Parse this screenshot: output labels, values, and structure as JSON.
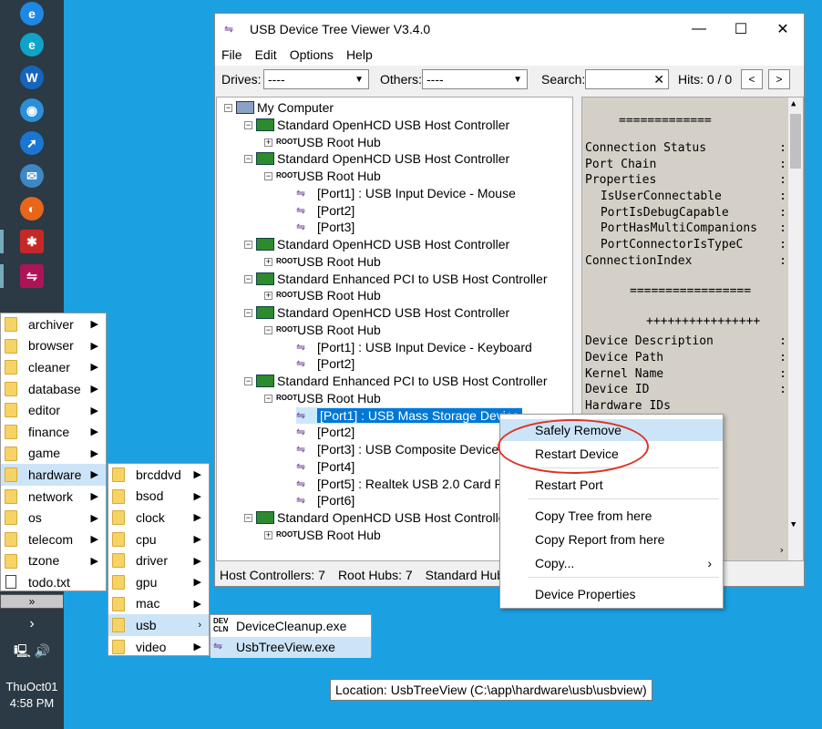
{
  "window": {
    "title": "USB Device Tree Viewer V3.4.0",
    "menu": [
      "File",
      "Edit",
      "Options",
      "Help"
    ],
    "drives_label": "Drives:",
    "drives_value": "----",
    "others_label": "Others:",
    "others_value": "----",
    "search_label": "Search:",
    "hits_label": "Hits: 0 / 0",
    "prev": "<",
    "next": ">"
  },
  "tree": [
    {
      "label": "My Computer",
      "icon": "computer-icon"
    },
    {
      "label": "Standard OpenHCD USB Host Controller",
      "icon": "host-controller-icon"
    },
    {
      "label": "USB Root Hub",
      "icon": "root-hub-icon"
    },
    {
      "label": "Standard OpenHCD USB Host Controller",
      "icon": "host-controller-icon"
    },
    {
      "label": "USB Root Hub",
      "icon": "root-hub-icon"
    },
    {
      "label": "[Port1] : USB Input Device - Mouse",
      "icon": "usb-port-icon"
    },
    {
      "label": "[Port2]",
      "icon": "usb-port-icon"
    },
    {
      "label": "[Port3]",
      "icon": "usb-port-icon"
    },
    {
      "label": "Standard OpenHCD USB Host Controller",
      "icon": "host-controller-icon"
    },
    {
      "label": "USB Root Hub",
      "icon": "root-hub-icon"
    },
    {
      "label": "Standard Enhanced PCI to USB Host Controller",
      "icon": "host-controller-icon"
    },
    {
      "label": "USB Root Hub",
      "icon": "root-hub-icon"
    },
    {
      "label": "Standard OpenHCD USB Host Controller",
      "icon": "host-controller-icon"
    },
    {
      "label": "USB Root Hub",
      "icon": "root-hub-icon"
    },
    {
      "label": "[Port1] : USB Input Device - Keyboard",
      "icon": "usb-port-icon"
    },
    {
      "label": "[Port2]",
      "icon": "usb-port-icon"
    },
    {
      "label": "Standard Enhanced PCI to USB Host Controller",
      "icon": "host-controller-icon"
    },
    {
      "label": "USB Root Hub",
      "icon": "root-hub-icon"
    },
    {
      "label": "[Port1] : USB Mass Storage Device",
      "icon": "usb-port-icon"
    },
    {
      "label": "[Port2]",
      "icon": "usb-port-icon"
    },
    {
      "label": "[Port3] : USB Composite Device",
      "icon": "usb-port-icon"
    },
    {
      "label": "[Port4]",
      "icon": "usb-port-icon"
    },
    {
      "label": "[Port5] : Realtek USB 2.0 Card Rea",
      "icon": "usb-port-icon"
    },
    {
      "label": "[Port6]",
      "icon": "usb-port-icon"
    },
    {
      "label": "Standard OpenHCD USB Host Controller",
      "icon": "host-controller-icon"
    },
    {
      "label": "USB Root Hub",
      "icon": "root-hub-icon"
    }
  ],
  "details": [
    "=============",
    "Connection Status",
    "Port Chain",
    "Properties",
    " IsUserConnectable",
    " PortIsDebugCapable",
    " PortHasMultiCompanions",
    " PortConnectorIsTypeC",
    "ConnectionIndex",
    "=================",
    "++++++++++++++++ ",
    "Device Description",
    "Device Path",
    "Kernel Name",
    "Device ID",
    "Hardware IDs"
  ],
  "status": {
    "host_controllers": "Host Controllers: 7",
    "root_hubs": "Root Hubs: 7",
    "standard_hubs": "Standard Hub"
  },
  "context_menu": [
    "Safely Remove",
    "Restart Device",
    "Restart Port",
    "Copy Tree from here",
    "Copy Report from here",
    "Copy...",
    "Device Properties"
  ],
  "start_menu": {
    "categories": [
      "archiver",
      "browser",
      "cleaner",
      "database",
      "editor",
      "finance",
      "game",
      "hardware",
      "network",
      "os",
      "telecom",
      "tzone",
      "todo.txt"
    ],
    "hardware_sub": [
      "brcddvd",
      "bsod",
      "clock",
      "cpu",
      "driver",
      "gpu",
      "mac",
      "usb",
      "video"
    ],
    "usb_sub": [
      "DeviceCleanup.exe",
      "UsbTreeView.exe"
    ],
    "more": "»"
  },
  "tooltip": "Location: UsbTreeView (C:\\app\\hardware\\usb\\usbview)",
  "clock": {
    "date": "ThuOct01",
    "time": "4:58 PM"
  }
}
